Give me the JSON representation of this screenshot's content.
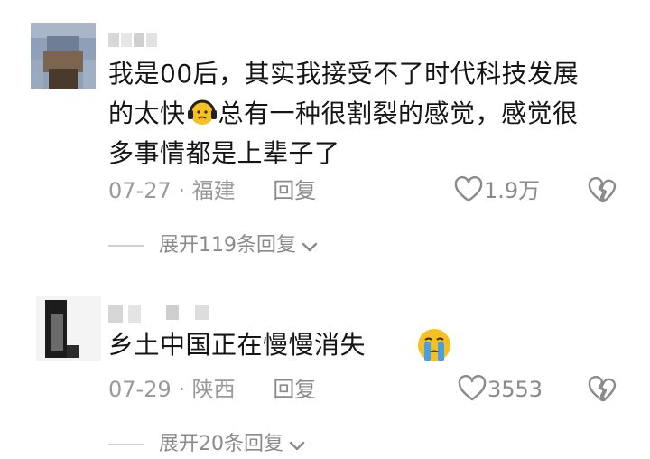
{
  "comments": [
    {
      "text_line1": "我是00后，其实我接受不了时代科技发展",
      "text_line2_pre": "的太快",
      "text_line2_post": "总有一种很割裂的感觉，感觉很",
      "text_line3": "多事情都是上辈子了",
      "inline_emoji": "headphone-sad-emoji",
      "date": "07-27",
      "location": "福建",
      "separator": "·",
      "reply_label": "回复",
      "like_count": "1.9万",
      "expand_label": "展开119条回复"
    },
    {
      "text": "乡土中国正在慢慢消失",
      "inline_emoji": "crying-emoji",
      "date": "07-29",
      "location": "陕西",
      "separator": "·",
      "reply_label": "回复",
      "like_count": "3553",
      "expand_label": "展开20条回复"
    }
  ],
  "colors": {
    "text": "#151515",
    "meta": "#9a9a9a",
    "emoji_yellow": "#f5c021",
    "emoji_blue": "#4a9fe0"
  }
}
